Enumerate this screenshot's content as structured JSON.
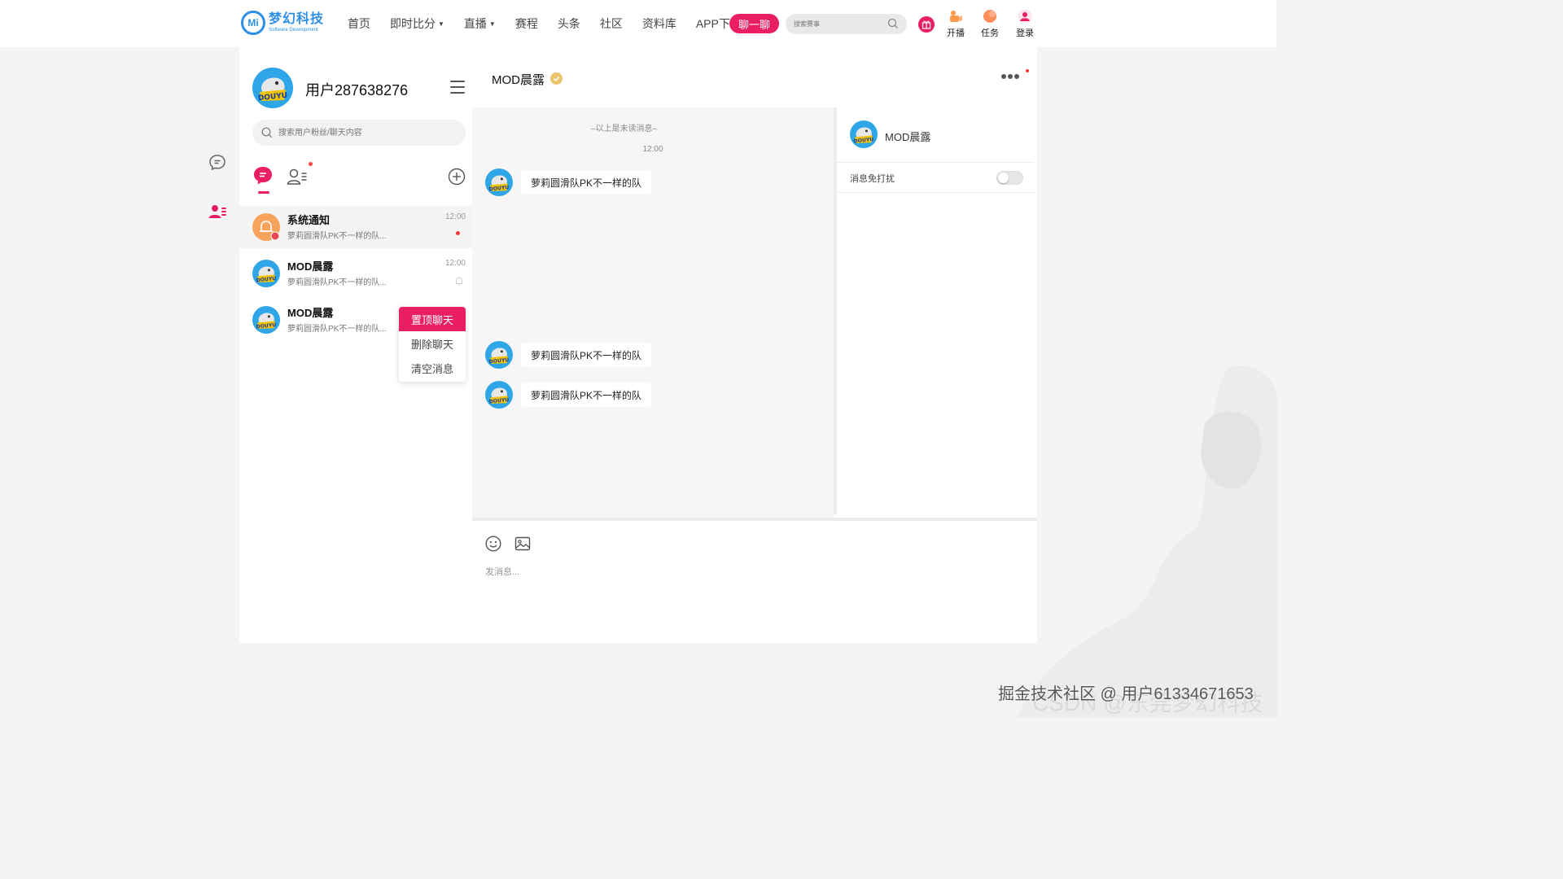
{
  "brand": {
    "name": "梦幻科技",
    "subtitle": "Software Development",
    "mark": "Mi",
    "color": "#2e8fe6"
  },
  "nav": {
    "items": [
      {
        "label": "首页",
        "caret": false
      },
      {
        "label": "即时比分",
        "caret": true
      },
      {
        "label": "直播",
        "caret": true
      },
      {
        "label": "赛程",
        "caret": false
      },
      {
        "label": "头条",
        "caret": false
      },
      {
        "label": "社区",
        "caret": false
      },
      {
        "label": "资料库",
        "caret": false
      },
      {
        "label": "APP下载",
        "caret": false
      }
    ],
    "chat_button": "聊一聊",
    "search_placeholder": "搜索赛事",
    "tools": [
      {
        "label": "开播",
        "icon": "camera-icon",
        "color": "#ff9a4d"
      },
      {
        "label": "任务",
        "icon": "task-icon",
        "color": "#ff8f5a"
      },
      {
        "label": "登录",
        "icon": "user-icon",
        "color": "#e91e63"
      }
    ]
  },
  "accent_color": "#e91e63",
  "profile": {
    "name": "用户287638276",
    "avatar_text": "DOUYU"
  },
  "sidebar": {
    "search_placeholder": "搜索用户粉丝/聊天内容",
    "conversations": [
      {
        "name": "系统通知",
        "preview": "萝莉圆滑队PK不一样的队...",
        "time": "12:00",
        "type": "system",
        "unread": true,
        "muted": false
      },
      {
        "name": "MOD晨露",
        "preview": "萝莉圆滑队PK不一样的队...",
        "time": "12:00",
        "type": "user",
        "unread": false,
        "muted": true
      },
      {
        "name": "MOD晨露",
        "preview": "萝莉圆滑队PK不一样的队...",
        "time": "",
        "type": "user",
        "unread": false,
        "muted": false
      }
    ],
    "context_menu": [
      "置顶聊天",
      "删除聊天",
      "清空消息"
    ]
  },
  "chat": {
    "title": "MOD晨露",
    "unread_divider": "–以上是未读消息–",
    "time_label": "12:00",
    "messages": [
      {
        "text": "萝莉圆滑队PK不一样的队"
      },
      {
        "text": "萝莉圆滑队PK不一样的队"
      },
      {
        "text": "萝莉圆滑队PK不一样的队"
      }
    ],
    "input_placeholder": "发消息..."
  },
  "info_panel": {
    "name": "MOD晨露",
    "dnd_label": "消息免打扰",
    "dnd_on": false
  },
  "watermark": "掘金技术社区 @ 用户61334671653",
  "watermark_bg": "CSDN @东莞梦幻科技"
}
